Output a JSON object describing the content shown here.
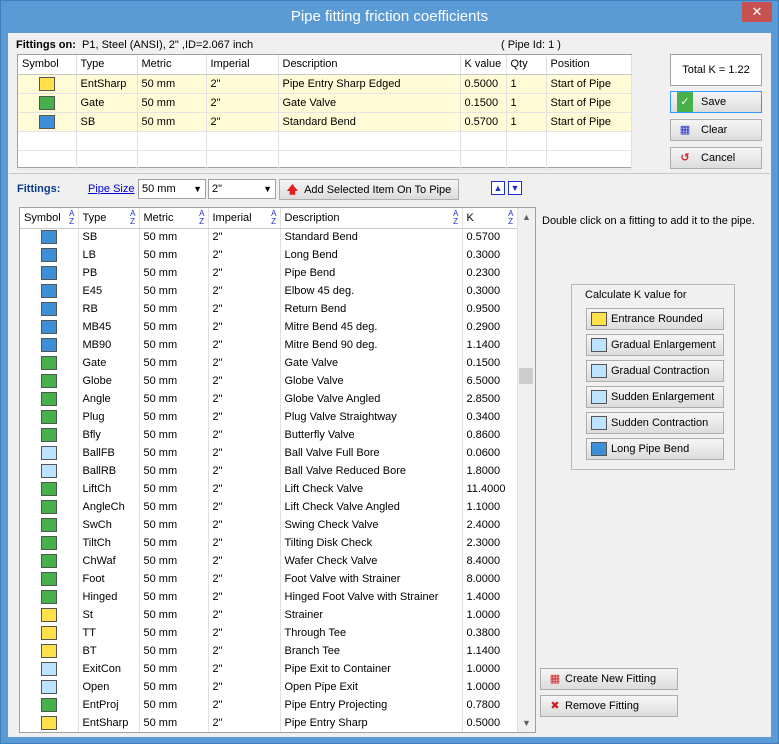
{
  "window": {
    "title": "Pipe fitting friction coefficients",
    "close_label": "✕"
  },
  "top": {
    "label": "Fittings on:",
    "pipe_info": "P1, Steel (ANSI), 2\" ,ID=2.067 inch",
    "pipe_id": "( Pipe Id: 1 )",
    "headers": [
      "Symbol",
      "Type",
      "Metric",
      "Imperial",
      "Description",
      "K value",
      "Qty",
      "Position"
    ],
    "rows": [
      {
        "icon": "entrance-sharp-icon",
        "type": "EntSharp",
        "metric": "50 mm",
        "imperial": "2\"",
        "desc": "Pipe Entry Sharp Edged",
        "k": "0.5000",
        "qty": "1",
        "pos": "Start of Pipe"
      },
      {
        "icon": "gate-valve-icon",
        "type": "Gate",
        "metric": "50 mm",
        "imperial": "2\"",
        "desc": "Gate Valve",
        "k": "0.1500",
        "qty": "1",
        "pos": "Start of Pipe"
      },
      {
        "icon": "standard-bend-icon",
        "type": "SB",
        "metric": "50 mm",
        "imperial": "2\"",
        "desc": "Standard Bend",
        "k": "0.5700",
        "qty": "1",
        "pos": "Start of Pipe"
      }
    ],
    "total_k": "Total K = 1.22",
    "save_label": "Save",
    "clear_label": "Clear",
    "cancel_label": "Cancel"
  },
  "mid": {
    "label": "Fittings:",
    "pipe_size_link": "Pipe Size",
    "metric_value": "50 mm",
    "imperial_value": "2\"",
    "add_label": "Add Selected Item On To Pipe"
  },
  "list": {
    "headers": [
      "Symbol",
      "Type",
      "Metric",
      "Imperial",
      "Description",
      "K"
    ],
    "rows": [
      [
        "SB",
        "50 mm",
        "2\"",
        "Standard Bend",
        "0.5700"
      ],
      [
        "LB",
        "50 mm",
        "2\"",
        "Long Bend",
        "0.3000"
      ],
      [
        "PB",
        "50 mm",
        "2\"",
        "Pipe Bend",
        "0.2300"
      ],
      [
        "E45",
        "50 mm",
        "2\"",
        "Elbow 45 deg.",
        "0.3000"
      ],
      [
        "RB",
        "50 mm",
        "2\"",
        "Return Bend",
        "0.9500"
      ],
      [
        "MB45",
        "50 mm",
        "2\"",
        "Mitre Bend 45 deg.",
        "0.2900"
      ],
      [
        "MB90",
        "50 mm",
        "2\"",
        "Mitre Bend 90 deg.",
        "1.1400"
      ],
      [
        "Gate",
        "50 mm",
        "2\"",
        "Gate Valve",
        "0.1500"
      ],
      [
        "Globe",
        "50 mm",
        "2\"",
        "Globe Valve",
        "6.5000"
      ],
      [
        "Angle",
        "50 mm",
        "2\"",
        "Globe Valve Angled",
        "2.8500"
      ],
      [
        "Plug",
        "50 mm",
        "2\"",
        "Plug Valve Straightway",
        "0.3400"
      ],
      [
        "Bfly",
        "50 mm",
        "2\"",
        "Butterfly Valve",
        "0.8600"
      ],
      [
        "BallFB",
        "50 mm",
        "2\"",
        "Ball Valve Full Bore",
        "0.0600"
      ],
      [
        "BallRB",
        "50 mm",
        "2\"",
        "Ball Valve Reduced Bore",
        "1.8000"
      ],
      [
        "LiftCh",
        "50 mm",
        "2\"",
        "Lift Check Valve",
        "11.4000"
      ],
      [
        "AngleCh",
        "50 mm",
        "2\"",
        "Lift Check Valve Angled",
        "1.1000"
      ],
      [
        "SwCh",
        "50 mm",
        "2\"",
        "Swing Check Valve",
        "2.4000"
      ],
      [
        "TiltCh",
        "50 mm",
        "2\"",
        "Tilting Disk Check",
        "2.3000"
      ],
      [
        "ChWaf",
        "50 mm",
        "2\"",
        "Wafer Check Valve",
        "8.4000"
      ],
      [
        "Foot",
        "50 mm",
        "2\"",
        "Foot Valve with Strainer",
        "8.0000"
      ],
      [
        "Hinged",
        "50 mm",
        "2\"",
        "Hinged Foot Valve with Strainer",
        "1.4000"
      ],
      [
        "St",
        "50 mm",
        "2\"",
        "Strainer",
        "1.0000"
      ],
      [
        "TT",
        "50 mm",
        "2\"",
        "Through Tee",
        "0.3800"
      ],
      [
        "BT",
        "50 mm",
        "2\"",
        "Branch Tee",
        "1.1400"
      ],
      [
        "ExitCon",
        "50 mm",
        "2\"",
        "Pipe Exit to Container",
        "1.0000"
      ],
      [
        "Open",
        "50 mm",
        "2\"",
        "Open Pipe Exit",
        "1.0000"
      ],
      [
        "EntProj",
        "50 mm",
        "2\"",
        "Pipe Entry Projecting",
        "0.7800"
      ],
      [
        "EntSharp",
        "50 mm",
        "2\"",
        "Pipe Entry Sharp",
        "0.5000"
      ]
    ]
  },
  "side": {
    "hint": "Double click on a fitting to add it to the pipe.",
    "calc_title": "Calculate K value for",
    "calc_buttons": [
      "Entrance Rounded",
      "Gradual Enlargement",
      "Gradual Contraction",
      "Sudden Enlargement",
      "Sudden Contraction",
      "Long Pipe Bend"
    ],
    "create_label": "Create New Fitting",
    "remove_label": "Remove Fitting"
  }
}
